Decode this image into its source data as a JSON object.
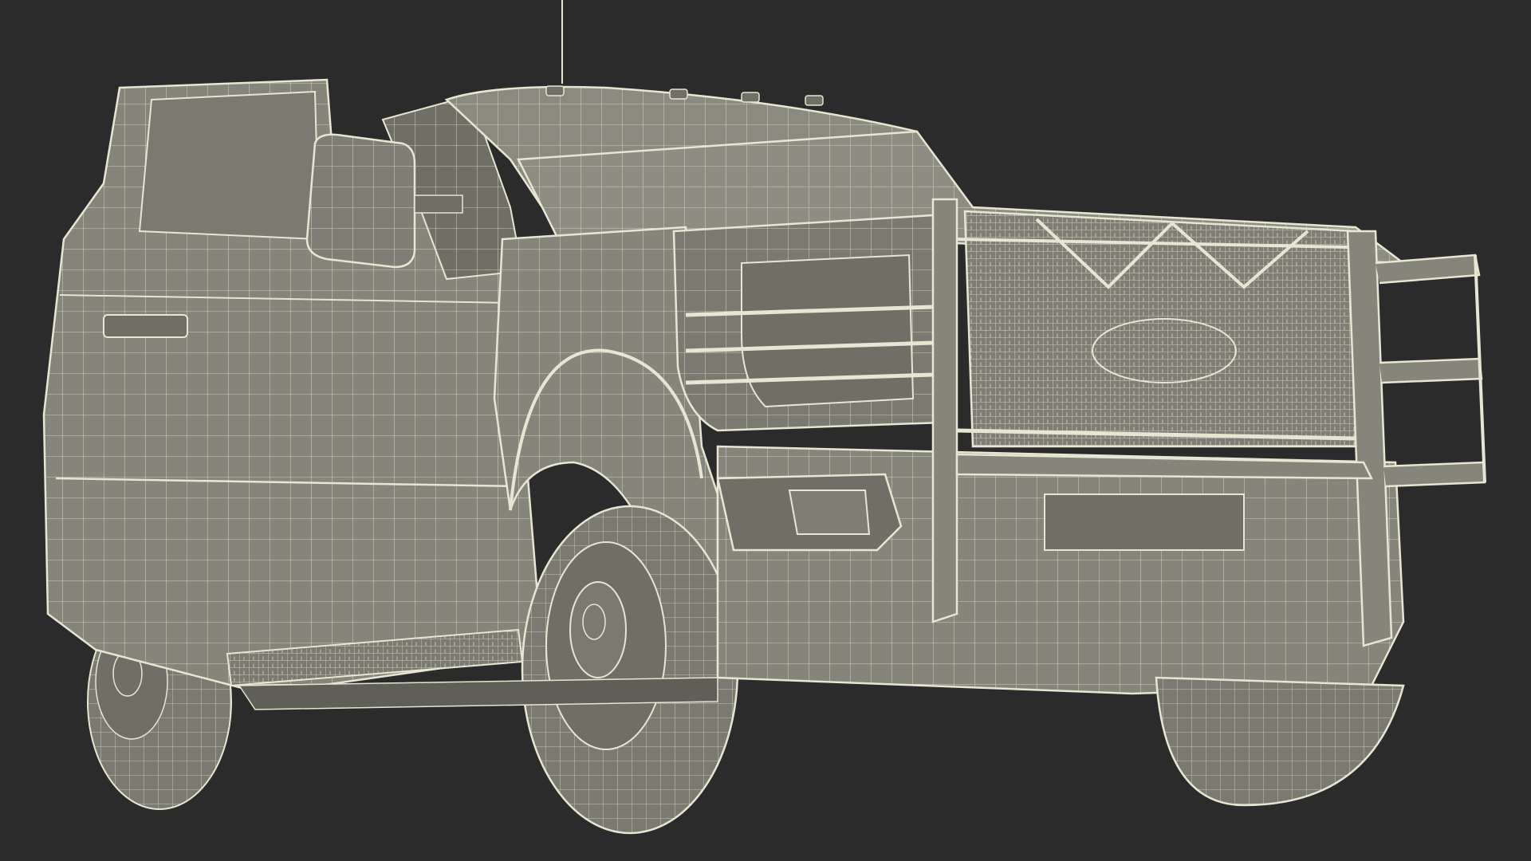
{
  "scene": {
    "background": "#2b2b2b",
    "model_fill": "#85857a",
    "model_fill_dark": "#6f6f65",
    "wire_color": "#e6e6d2"
  },
  "icons": {
    "subject": "wireframe-pickup-truck"
  }
}
